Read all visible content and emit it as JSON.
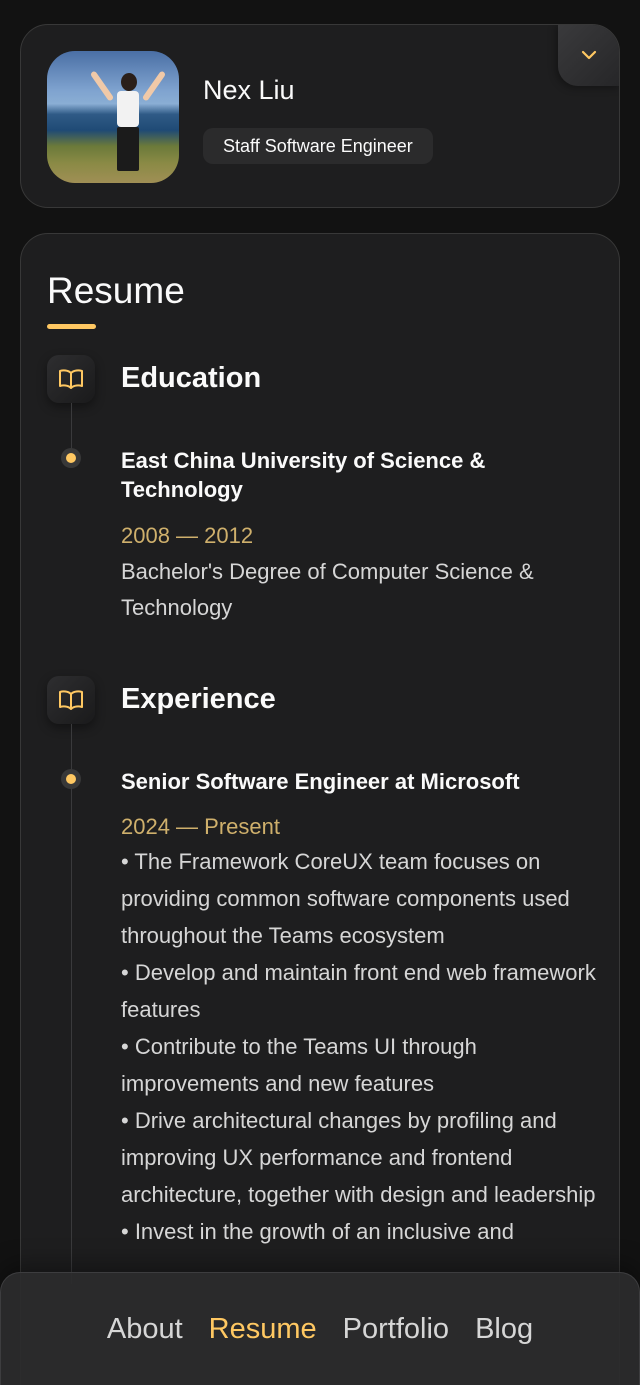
{
  "profile": {
    "name": "Nex Liu",
    "title": "Staff Software Engineer",
    "toggle_icon": "chevron-down-icon"
  },
  "resume": {
    "title": "Resume",
    "education": {
      "heading": "Education",
      "icon": "book-icon",
      "items": [
        {
          "school": "East China University of Science & Technology",
          "dates": "2008 — 2012",
          "degree": "Bachelor's Degree of Computer Science & Technology"
        }
      ]
    },
    "experience": {
      "heading": "Experience",
      "icon": "book-icon",
      "items": [
        {
          "title": "Senior Software Engineer at Microsoft",
          "dates": "2024 — Present",
          "bullets": [
            "• The Framework CoreUX team focuses on providing common software components used throughout the Teams ecosystem",
            "• Develop and maintain front end web framework features",
            "• Contribute to the Teams UI through improvements and new features",
            "• Drive architectural changes by profiling and improving UX performance and frontend architecture, together with design and leadership",
            "• Invest in the growth of an inclusive and"
          ]
        }
      ]
    }
  },
  "navbar": {
    "links": [
      "About",
      "Resume",
      "Portfolio",
      "Blog"
    ],
    "active": "Resume"
  },
  "colors": {
    "accent": "#ffc862",
    "background": "#121212",
    "card": "#1e1e1f",
    "date": "#cfb06c"
  }
}
